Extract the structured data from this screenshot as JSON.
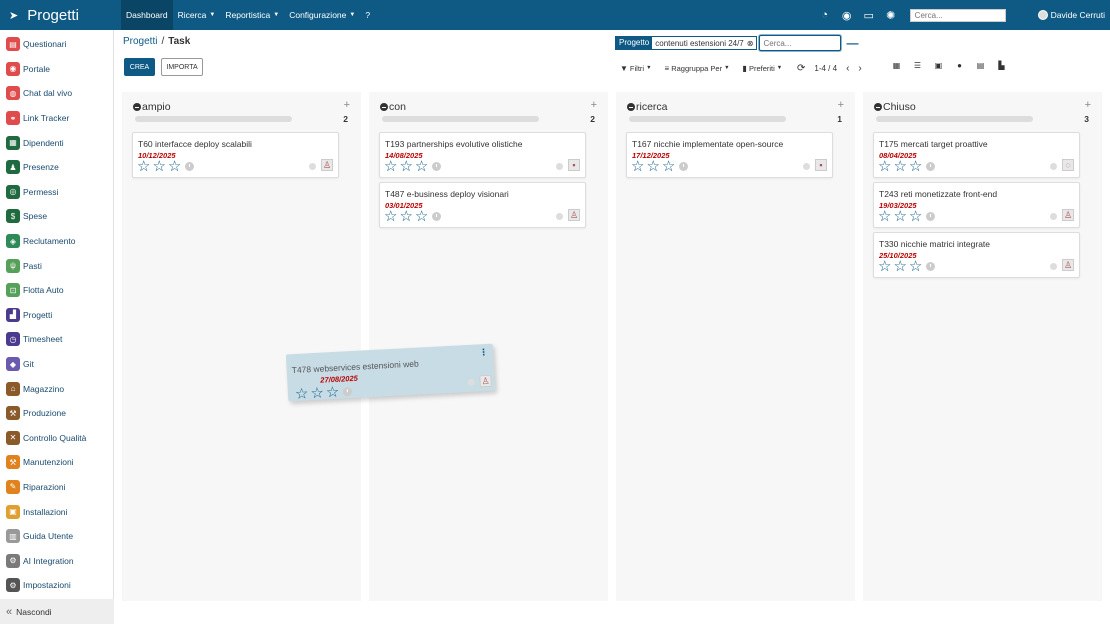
{
  "app": {
    "title": "Progetti",
    "brand_icon": "paper-plane-icon"
  },
  "topnav": {
    "items": [
      {
        "label": "Dashboard",
        "active": true,
        "dropdown": false
      },
      {
        "label": "Ricerca",
        "active": false,
        "dropdown": true
      },
      {
        "label": "Reportistica",
        "active": false,
        "dropdown": true
      },
      {
        "label": "Configurazione",
        "active": false,
        "dropdown": true
      },
      {
        "label": "?",
        "active": false,
        "dropdown": false
      }
    ],
    "search_placeholder": "Cerca...",
    "user_name": "Davide Cerruti"
  },
  "sidebar": {
    "items": [
      {
        "label": "Questionari",
        "color": "#e04b4b",
        "icon": "clipboard-icon",
        "glyph": "▤"
      },
      {
        "label": "Portale",
        "color": "#e04b4b",
        "icon": "globe-icon",
        "glyph": "◉"
      },
      {
        "label": "Chat dal vivo",
        "color": "#e04b4b",
        "icon": "chat-icon",
        "glyph": "◍"
      },
      {
        "label": "Link Tracker",
        "color": "#e04b4b",
        "icon": "link-icon",
        "glyph": "⚭"
      },
      {
        "label": "Dipendenti",
        "color": "#1f6b3f",
        "icon": "employees-icon",
        "glyph": "▦"
      },
      {
        "label": "Presenze",
        "color": "#1f6b3f",
        "icon": "attendance-icon",
        "glyph": "♟"
      },
      {
        "label": "Permessi",
        "color": "#1f6b3f",
        "icon": "leave-icon",
        "glyph": "◎"
      },
      {
        "label": "Spese",
        "color": "#1f6b3f",
        "icon": "expenses-icon",
        "glyph": "$"
      },
      {
        "label": "Reclutamento",
        "color": "#2e8b57",
        "icon": "recruitment-icon",
        "glyph": "◈"
      },
      {
        "label": "Pasti",
        "color": "#56a05a",
        "icon": "cutlery-icon",
        "glyph": "ψ"
      },
      {
        "label": "Flotta Auto",
        "color": "#56a05a",
        "icon": "car-icon",
        "glyph": "⊡"
      },
      {
        "label": "Progetti",
        "color": "#4b3b8f",
        "icon": "projects-icon",
        "glyph": "▟"
      },
      {
        "label": "Timesheet",
        "color": "#4b3b8f",
        "icon": "timesheet-icon",
        "glyph": "◷"
      },
      {
        "label": "Git",
        "color": "#6a5ab0",
        "icon": "git-icon",
        "glyph": "◆"
      },
      {
        "label": "Magazzino",
        "color": "#8b5a2b",
        "icon": "warehouse-icon",
        "glyph": "⌂"
      },
      {
        "label": "Produzione",
        "color": "#8b5a2b",
        "icon": "wrench-icon",
        "glyph": "⚒"
      },
      {
        "label": "Controllo Qualità",
        "color": "#8b5a2b",
        "icon": "quality-icon",
        "glyph": "✕"
      },
      {
        "label": "Manutenzioni",
        "color": "#e0821e",
        "icon": "hammer-icon",
        "glyph": "⚒"
      },
      {
        "label": "Riparazioni",
        "color": "#e0821e",
        "icon": "repair-icon",
        "glyph": "✎"
      },
      {
        "label": "Installazioni",
        "color": "#e0a030",
        "icon": "installations-icon",
        "glyph": "▣"
      },
      {
        "label": "Guida Utente",
        "color": "#999999",
        "icon": "user-guide-icon",
        "glyph": "▥"
      },
      {
        "label": "AI Integration",
        "color": "#7a7a7a",
        "icon": "ai-icon",
        "glyph": "⚙"
      },
      {
        "label": "Impostazioni",
        "color": "#555555",
        "icon": "settings-icon",
        "glyph": "⚙"
      }
    ],
    "hide_label": "Nascondi"
  },
  "breadcrumb": {
    "parent": "Progetti",
    "separator": "/",
    "current": "Task"
  },
  "buttons": {
    "create": "CREA",
    "import": "IMPORTA"
  },
  "search": {
    "facet_label": "Progetto",
    "facet_value": "contenuti estensioni 24/7",
    "placeholder": "Cerca..."
  },
  "controls": {
    "filters": "Filtri",
    "group_by": "Raggruppa Per",
    "favorites": "Preferiti"
  },
  "pager": {
    "value": "1-4 / 4"
  },
  "accent_color": "#0e5a84",
  "kanban": {
    "columns": [
      {
        "name": "ampio",
        "count": "2",
        "cards": [
          {
            "title": "T60 interfacce deploy scalabili",
            "date": "10/12/2025",
            "avatar": "person-avatar"
          }
        ]
      },
      {
        "name": "con",
        "count": "2",
        "cards": [
          {
            "title": "T193 partnerships evolutive olistiche",
            "date": "14/08/2025",
            "avatar": "photo-avatar"
          },
          {
            "title": "T487 e-business deploy visionari",
            "date": "03/01/2025",
            "avatar": "person-avatar"
          }
        ]
      },
      {
        "name": "ricerca",
        "count": "1",
        "cards": [
          {
            "title": "T167 nicchie implementate open-source",
            "date": "17/12/2025",
            "avatar": "photo-avatar"
          }
        ]
      },
      {
        "name": "Chiuso",
        "count": "3",
        "cards": [
          {
            "title": "T175 mercati target proattive",
            "date": "08/04/2025",
            "avatar": "placeholder-avatar"
          },
          {
            "title": "T243 reti monetizzate front-end",
            "date": "19/03/2025",
            "avatar": "person-avatar"
          },
          {
            "title": "T330 nicchie matrici integrate",
            "date": "25/10/2025",
            "avatar": "person-avatar"
          }
        ]
      }
    ],
    "dragged_card": {
      "title": "T478 webservices estensioni web",
      "date": "27/08/2025",
      "avatar": "person-avatar"
    }
  }
}
